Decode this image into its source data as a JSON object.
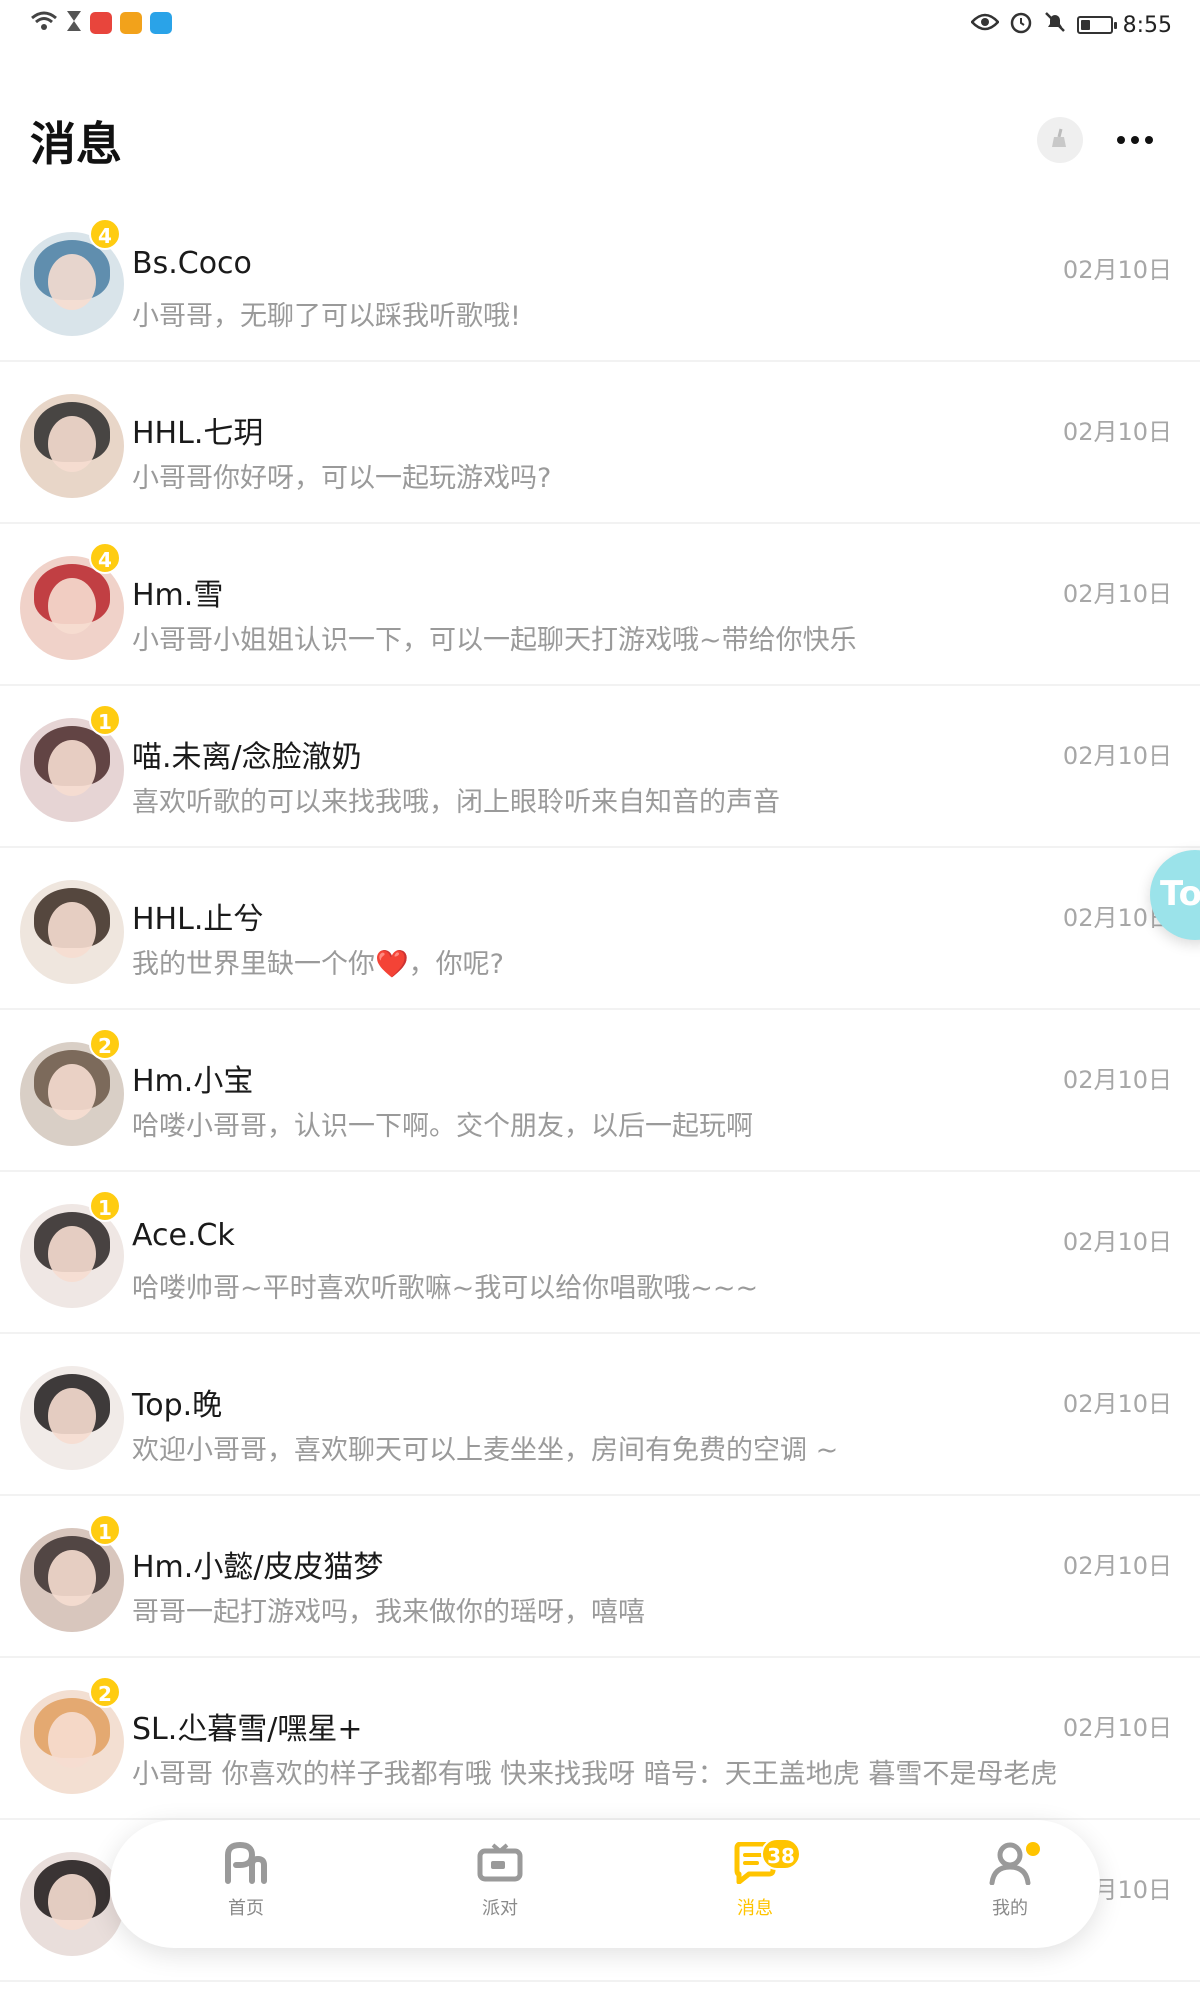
{
  "status_bar": {
    "time": "8:55",
    "left_icons": [
      "wifi-icon",
      "hourglass-icon",
      "app-red-icon",
      "app-orange-icon",
      "app-blue-search-icon"
    ],
    "right_icons": [
      "eye-icon",
      "alarm-icon",
      "bell-mute-icon",
      "battery-icon"
    ],
    "battery_level": 0.3
  },
  "header": {
    "title": "消息",
    "clean_icon": "broom-icon",
    "more_icon": "more-icon"
  },
  "messages": [
    {
      "name": "Bs.Coco",
      "preview": "小哥哥，无聊了可以踩我听歌哦!",
      "time": "02月10日",
      "badge": "4",
      "avatar_color": "#4a7fa3",
      "avatar_bg": "#d9e4ea"
    },
    {
      "name": "HHL.七玥",
      "preview": "小哥哥你好呀，可以一起玩游戏吗?",
      "time": "02月10日",
      "badge": "",
      "avatar_color": "#2b2b2b",
      "avatar_bg": "#e8d6c8"
    },
    {
      "name": "Hm.雪",
      "preview": "小哥哥小姐姐认识一下，可以一起聊天打游戏哦~带给你快乐",
      "time": "02月10日",
      "badge": "4",
      "avatar_color": "#b8262c",
      "avatar_bg": "#f0d2c9"
    },
    {
      "name": "喵.未离/念脸澈奶",
      "preview": "喜欢听歌的可以来找我哦，闭上眼聆听来自知音的声音",
      "time": "02月10日",
      "badge": "1",
      "avatar_color": "#4a2a2a",
      "avatar_bg": "#e6d4d4"
    },
    {
      "name": "HHL.止兮",
      "preview": "我的世界里缺一个你❤️，你呢?",
      "time": "02月10日",
      "badge": "",
      "avatar_color": "#3a2a22",
      "avatar_bg": "#efe6de"
    },
    {
      "name": "Hm.小宝",
      "preview": "哈喽小哥哥，认识一下啊。交个朋友，以后一起玩啊",
      "time": "02月10日",
      "badge": "2",
      "avatar_color": "#6b5848",
      "avatar_bg": "#d9cfc6"
    },
    {
      "name": "Ace.Ck",
      "preview": "哈喽帅哥~平时喜欢听歌嘛~我可以给你唱歌哦~~~",
      "time": "02月10日",
      "badge": "1",
      "avatar_color": "#2a2424",
      "avatar_bg": "#efe7e4"
    },
    {
      "name": "Top.晚",
      "preview": "欢迎小哥哥，喜欢聊天可以上麦坐坐，房间有免费的空调 ~",
      "time": "02月10日",
      "badge": "",
      "avatar_color": "#1f1b1b",
      "avatar_bg": "#f1ebe8"
    },
    {
      "name": "Hm.小懿/皮皮猫梦",
      "preview": "哥哥一起打游戏吗，我来做你的瑶呀，嘻嘻",
      "time": "02月10日",
      "badge": "1",
      "avatar_color": "#3b2f2f",
      "avatar_bg": "#d8c6bd"
    },
    {
      "name": "SL.尐暮雪/嘿星+",
      "preview": "小哥哥 你喜欢的样子我都有哦 快来找我呀 暗号：天王盖地虎 暮雪不是母老虎",
      "time": "02月10日",
      "badge": "2",
      "avatar_color": "#e0a060",
      "avatar_bg": "#f3dfd2"
    },
    {
      "name": "",
      "preview": "",
      "time": "02月10日",
      "badge": "",
      "avatar_color": "#1b1616",
      "avatar_bg": "#e9dedb"
    }
  ],
  "float_bubble": {
    "text": "To"
  },
  "bottom_nav": {
    "items": [
      {
        "label": "首页",
        "icon": "home-icon",
        "active": false
      },
      {
        "label": "派对",
        "icon": "tv-icon",
        "active": false
      },
      {
        "label": "消息",
        "icon": "message-icon",
        "active": true,
        "badge": "38"
      },
      {
        "label": "我的",
        "icon": "profile-icon",
        "active": false
      }
    ],
    "accent": "#ffc400",
    "inactive_color": "#8a8a8a"
  }
}
